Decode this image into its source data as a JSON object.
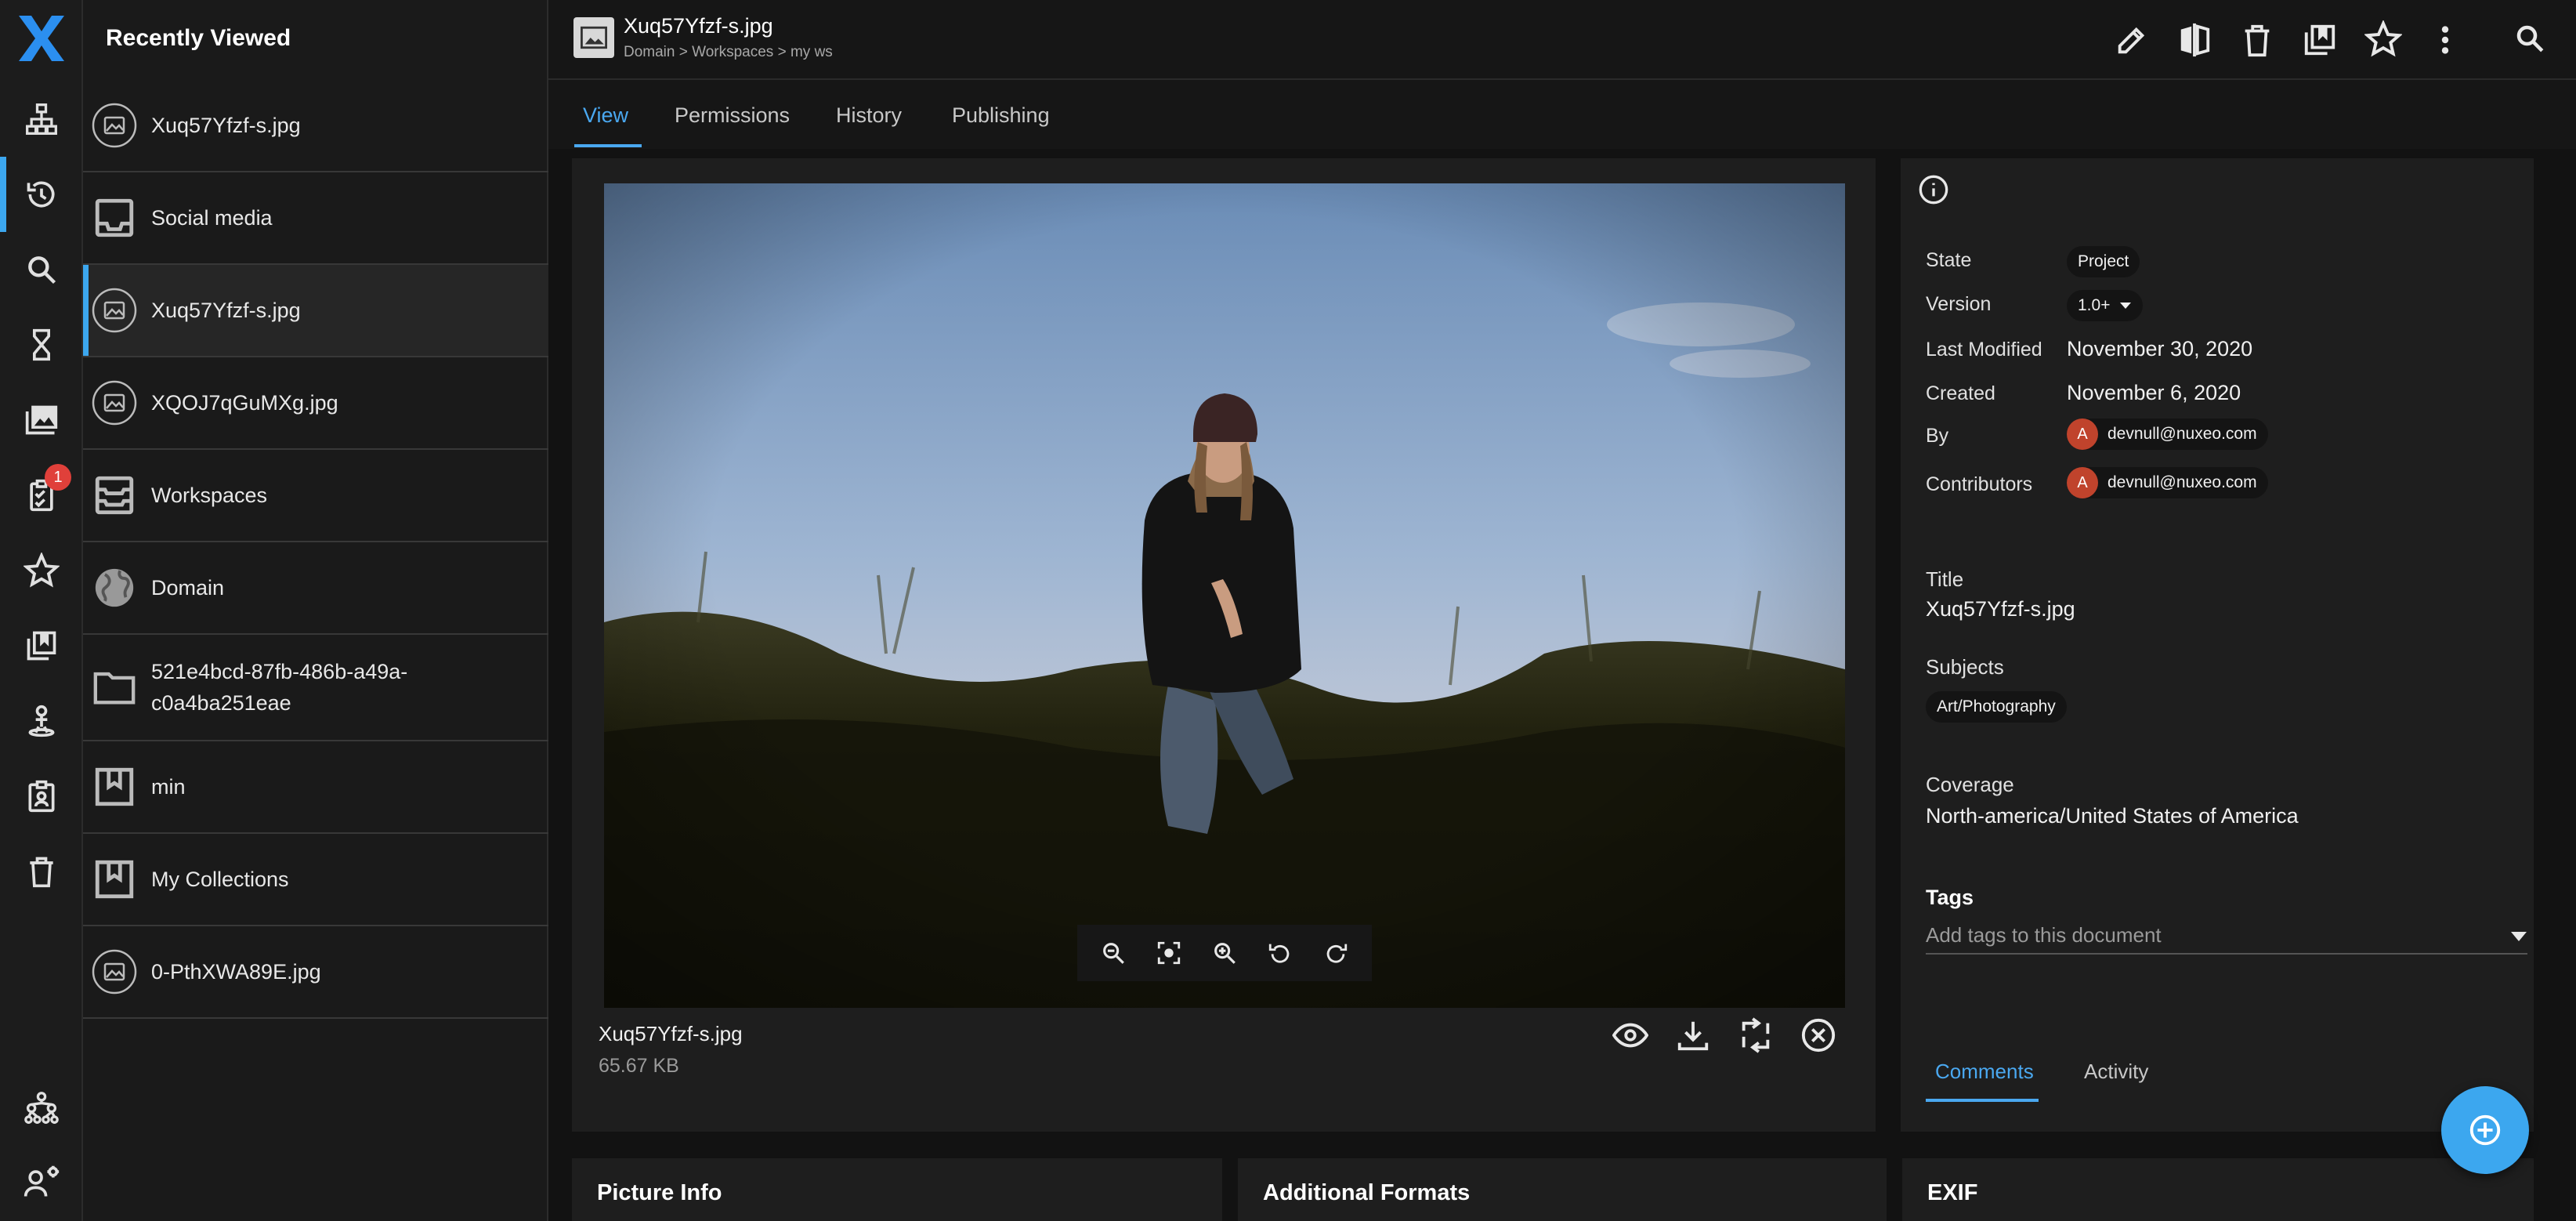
{
  "app": {
    "logo": "nuxeo-x-logo",
    "accent": "#3ca7ef"
  },
  "rail": {
    "items": [
      {
        "name": "browse-icon"
      },
      {
        "name": "recently-viewed-icon",
        "active": true
      },
      {
        "name": "search-icon"
      },
      {
        "name": "expired-icon"
      },
      {
        "name": "assets-icon"
      },
      {
        "name": "tasks-icon",
        "badge": "1"
      },
      {
        "name": "favorites-icon"
      },
      {
        "name": "collections-icon"
      },
      {
        "name": "personal-workspace-icon"
      },
      {
        "name": "clipboard-icon"
      },
      {
        "name": "trash-icon"
      },
      {
        "name": "hierarchy-icon"
      },
      {
        "name": "user-settings-icon"
      }
    ]
  },
  "drawer": {
    "title": "Recently Viewed",
    "items": [
      {
        "label": "Xuq57Yfzf-s.jpg",
        "icon": "picture-icon"
      },
      {
        "label": "Social media",
        "icon": "inbox-icon"
      },
      {
        "label": "Xuq57Yfzf-s.jpg",
        "icon": "picture-icon",
        "selected": true
      },
      {
        "label": "XQOJ7qGuMXg.jpg",
        "icon": "picture-icon"
      },
      {
        "label": "Workspaces",
        "icon": "workspaces-icon"
      },
      {
        "label": "Domain",
        "icon": "globe-icon"
      },
      {
        "label": "521e4bcd-87fb-486b-a49a-c0a4ba251eae",
        "icon": "folder-icon"
      },
      {
        "label": "min",
        "icon": "collection-icon"
      },
      {
        "label": "My Collections",
        "icon": "collection-icon"
      },
      {
        "label": "0-PthXWA89E.jpg",
        "icon": "picture-icon"
      }
    ]
  },
  "header": {
    "title": "Xuq57Yfzf-s.jpg",
    "breadcrumb": "Domain > Workspaces > my ws",
    "actions": [
      "edit-icon",
      "compare-icon",
      "delete-icon",
      "add-to-collection-icon",
      "favorite-icon",
      "more-icon",
      "search-icon"
    ]
  },
  "tabs": [
    {
      "label": "View",
      "active": true
    },
    {
      "label": "Permissions"
    },
    {
      "label": "History"
    },
    {
      "label": "Publishing"
    }
  ],
  "viewer": {
    "file_name": "Xuq57Yfzf-s.jpg",
    "file_size": "65.67 KB",
    "zoom_controls": [
      "zoom-out-icon",
      "fit-icon",
      "zoom-in-icon",
      "rotate-left-icon",
      "rotate-right-icon"
    ],
    "file_actions": [
      "preview-icon",
      "download-icon",
      "replace-icon",
      "remove-icon"
    ]
  },
  "metadata": {
    "state_label": "State",
    "state": "Project",
    "version_label": "Version",
    "version": "1.0+",
    "last_modified_label": "Last Modified",
    "last_modified": "November 30, 2020",
    "created_label": "Created",
    "created": "November 6, 2020",
    "by_label": "By",
    "by_avatar": "A",
    "by": "devnull@nuxeo.com",
    "contributors_label": "Contributors",
    "contributors_avatar": "A",
    "contributors": "devnull@nuxeo.com",
    "title_label": "Title",
    "title": "Xuq57Yfzf-s.jpg",
    "subjects_label": "Subjects",
    "subject": "Art/Photography",
    "coverage_label": "Coverage",
    "coverage": "North-america/United States of America",
    "tags_label": "Tags",
    "tags_placeholder": "Add tags to this document",
    "tabs": [
      {
        "label": "Comments",
        "active": true
      },
      {
        "label": "Activity"
      }
    ]
  },
  "cards": [
    {
      "title": "Picture Info"
    },
    {
      "title": "Additional Formats"
    },
    {
      "title": "EXIF"
    }
  ]
}
